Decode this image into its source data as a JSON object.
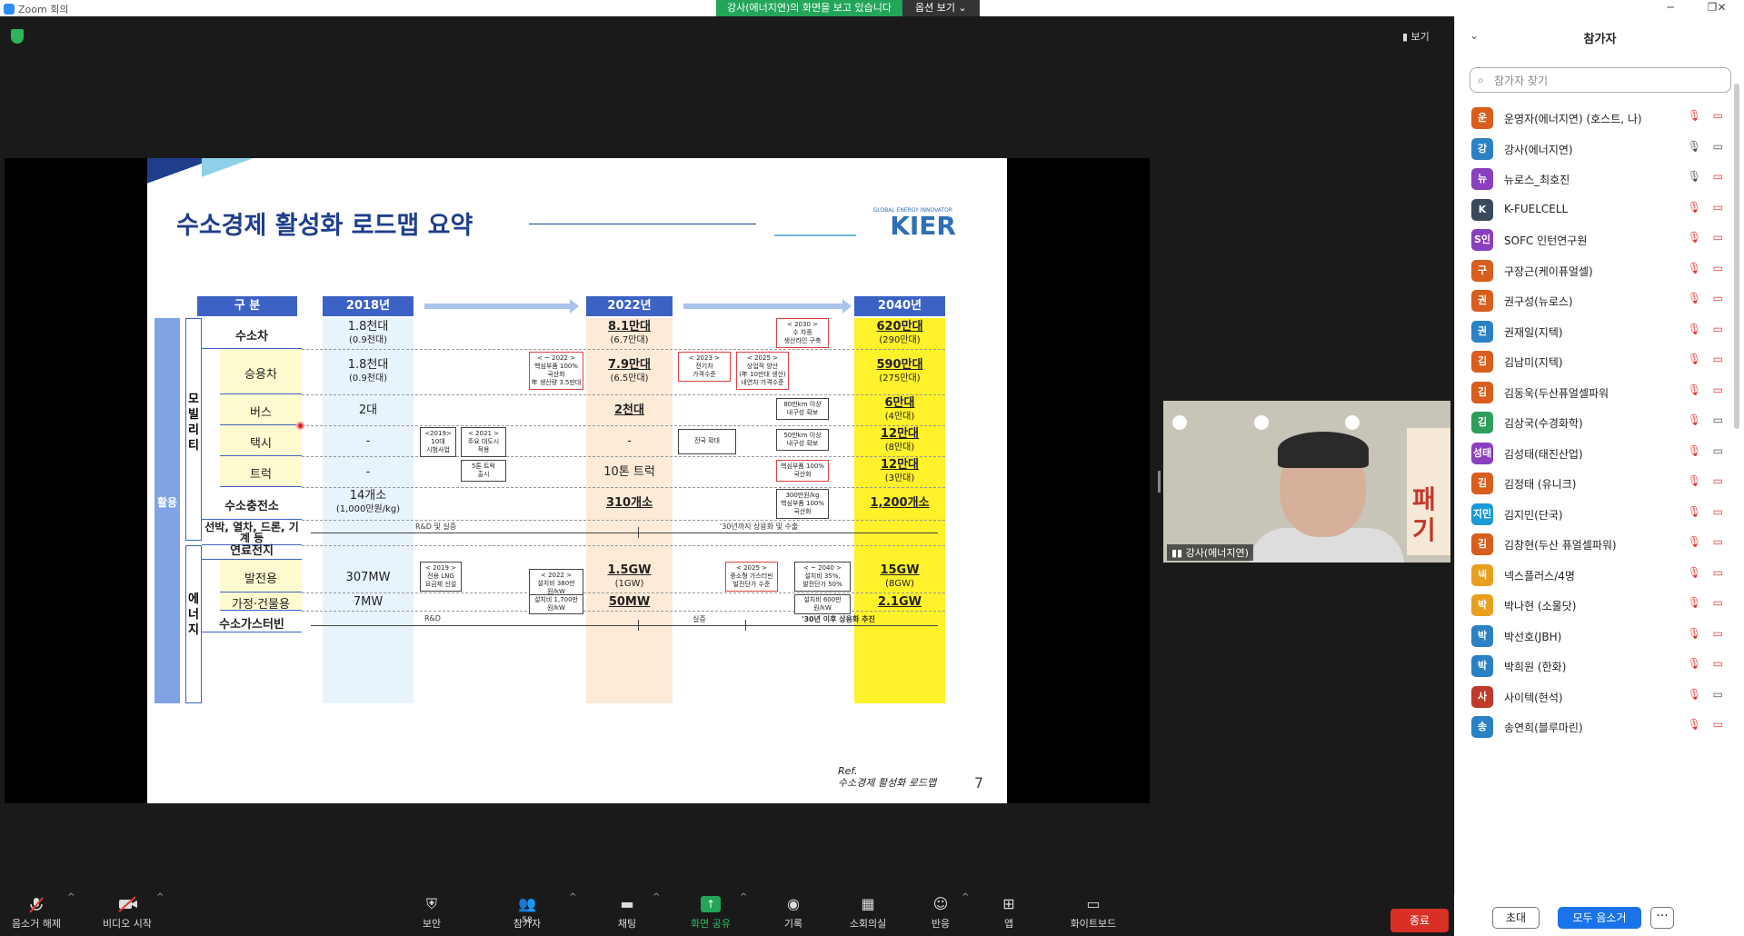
{
  "window": {
    "title": "Zoom 회의",
    "minimize": "─",
    "restore": "❐",
    "close": "✕"
  },
  "share_banner": {
    "text": "강사(에너지연)의 화면을 보고 있습니다",
    "options": "옵션 보기 ⌄"
  },
  "view_button": "▮ 보기",
  "slide": {
    "title": "수소경제 활성화 로드맵 요약",
    "logo": "KIER",
    "logo_sub": "GLOBAL ENERGY INNOVATOR",
    "ref_label": "Ref.",
    "ref_text": "수소경제 활성화 로드맵",
    "page": "7",
    "headers": {
      "gubun": "구  분",
      "y2018": "2018년",
      "y2022": "2022년",
      "y2040": "2040년"
    },
    "categories": {
      "use": "활용",
      "mobility": "모빌리티",
      "energy": "에너지"
    },
    "rows": {
      "fcev": {
        "label": "수소차",
        "v2018": "1.8천대",
        "v2018s": "(0.9천대)",
        "v2022": "8.1만대",
        "v2022s": "(6.7만대)",
        "v2040": "620만대",
        "v2040s": "(290만대)"
      },
      "car": {
        "label": "승용차",
        "v2018": "1.8천대",
        "v2018s": "(0.9천대)",
        "v2022": "7.9만대",
        "v2022s": "(6.5만대)",
        "v2040": "590만대",
        "v2040s": "(275만대)"
      },
      "bus": {
        "label": "버스",
        "v2018": "2대",
        "v2022": "2천대",
        "v2040": "6만대",
        "v2040s": "(4만대)"
      },
      "taxi": {
        "label": "택시",
        "v2018": "-",
        "v2022": "-",
        "v2040": "12만대",
        "v2040s": "(8만대)"
      },
      "truck": {
        "label": "트럭",
        "v2018": "-",
        "v2022": "10톤 트럭",
        "v2040": "12만대",
        "v2040s": "(3만대)"
      },
      "station": {
        "label": "수소충전소",
        "v2018": "14개소",
        "v2018s": "(1,000만원/kg)",
        "v2022": "310개소",
        "v2040": "1,200개소"
      },
      "ship": {
        "label": "선박, 열차, 드론, 기계 등",
        "rd": "R&D 및 실증",
        "comm": "'30년까지 상용화 및 수출"
      },
      "fc": {
        "label": "연료전지"
      },
      "power": {
        "label": "발전용",
        "v2018": "307MW",
        "v2022": "1.5GW",
        "v2022s": "(1GW)",
        "v2040": "15GW",
        "v2040s": "(8GW)"
      },
      "home": {
        "label": "가정·건물용",
        "v2018": "7MW",
        "v2022": "50MW",
        "v2040": "2.1GW"
      },
      "turbine": {
        "label": "수소가스터빈",
        "rd": "R&D",
        "demo": "실증",
        "comm": "'30년 이후 상용화 추진"
      }
    },
    "notes": {
      "n2030": "< 2030 >\n수 차종\n생산라인 구축",
      "n2022": "< ~ 2022 >\n핵심부품 100%\n국산화\n年 생산량 3.5만대",
      "n2023": "< 2023 >\n전기차\n가격수준",
      "n2025": "< 2025 >\n상업적 양산\n(年 10만대 생산)\n내연차 가격수준",
      "bus80": "80만km 이상\n내구성 확보",
      "taxi2019": "<2019>\n10대\n시범사업",
      "taxi2021": "< 2021 >\n주요 대도시\n적용",
      "nation": "전국 확대",
      "taxi50": "50만km 이상\n내구성 확보",
      "truck5": "5톤 트럭\n출시",
      "truckparts": "핵심부품 100%\n국산화",
      "st300": "300만원/kg\n핵심부품 100%\n국산화",
      "lng": "< 2019 >\n전용 LNG\n요금제 신설",
      "p2022": "< 2022 >\n설치비 380만원/kW",
      "gas2025": "< 2025 >\n중소형 가스터빈\n발전단가 수준",
      "p2040": "< ~ 2040 >\n설치비 35%,\n발전단가 50%",
      "h1700": "설치비 1,700만원/kW",
      "h600": "설치비 600만원/kW"
    }
  },
  "speaker": {
    "name": "강사(에너지연)"
  },
  "toolbar": {
    "unmute": "음소거 해제",
    "video": "비디오 시작",
    "security": "보안",
    "participants": "참가자",
    "participants_count": "58",
    "chat": "채팅",
    "share": "화면 공유",
    "record": "기록",
    "breakout": "소회의실",
    "reactions": "반응",
    "apps": "앱",
    "whiteboard": "화이트보드",
    "end": "종료"
  },
  "panel": {
    "title": "참가자",
    "search_placeholder": "참가자 찾기",
    "invite": "초대",
    "mute_all": "모두 음소거",
    "more": "···",
    "participants": [
      {
        "avatar": "운",
        "color": "#d95d1c",
        "name": "운영자(에너지연) (호스트, 나)"
      },
      {
        "avatar": "강",
        "color": "#2a82c4",
        "name": "강사(에너지연)"
      },
      {
        "avatar": "뉴",
        "color": "#8a3fbf",
        "name": "뉴로스_최호진"
      },
      {
        "avatar": "K",
        "color": "#3a4a5c",
        "name": "K-FUELCELL"
      },
      {
        "avatar": "S인",
        "color": "#8a3fbf",
        "name": "SOFC 인턴연구원"
      },
      {
        "avatar": "구",
        "color": "#d95d1c",
        "name": "구장근(케이퓨얼셀)"
      },
      {
        "avatar": "권",
        "color": "#d95d1c",
        "name": "권구성(뉴로스)"
      },
      {
        "avatar": "권",
        "color": "#2a82c4",
        "name": "권재일(지텍)"
      },
      {
        "avatar": "김",
        "color": "#d95d1c",
        "name": "김남미(지텍)"
      },
      {
        "avatar": "김",
        "color": "#d95d1c",
        "name": "김동욱(두산퓨얼셀파워"
      },
      {
        "avatar": "김",
        "color": "#2e9e5b",
        "name": "김상국(수경화학)"
      },
      {
        "avatar": "성태",
        "color": "#8a3fbf",
        "name": "김성태(태진산업)"
      },
      {
        "avatar": "김",
        "color": "#d95d1c",
        "name": "김정태 (유니크)"
      },
      {
        "avatar": "지민",
        "color": "#1a9ad6",
        "name": "김지민(단국)"
      },
      {
        "avatar": "김",
        "color": "#d95d1c",
        "name": "김창현(두산 퓨얼셀파워)"
      },
      {
        "avatar": "넥",
        "color": "#e8a020",
        "name": "넥스플러스/4명"
      },
      {
        "avatar": "박",
        "color": "#e8a020",
        "name": "박나현 (소울닷)"
      },
      {
        "avatar": "박",
        "color": "#2a82c4",
        "name": "박선호(JBH)"
      },
      {
        "avatar": "박",
        "color": "#2a82c4",
        "name": "박희원 (한화)"
      },
      {
        "avatar": "사",
        "color": "#c0392b",
        "name": "사이텍(현석)"
      },
      {
        "avatar": "송",
        "color": "#2a82c4",
        "name": "송연희(블루마린)"
      }
    ]
  }
}
